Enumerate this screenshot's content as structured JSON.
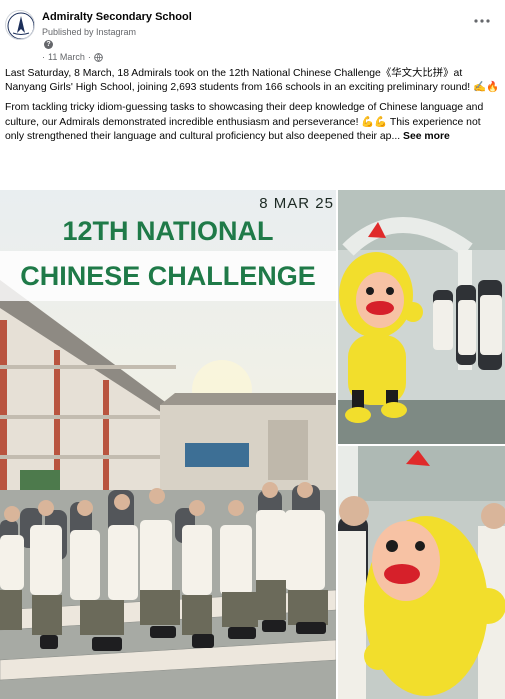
{
  "post": {
    "page_name": "Admiralty Secondary School",
    "published_by": "Published by Instagram",
    "meta_icon": "?",
    "date": "11 March",
    "date_separator": "·",
    "more_icon": "more-horizontal-icon",
    "privacy_icon": "globe-icon"
  },
  "text": {
    "p1": "Last Saturday, 8 March, 18 Admirals took on the 12th National Chinese Challenge《华文大比拼》at Nanyang Girls' High School, joining 2,693 students from 166 schools in an exciting preliminary round! ✍️🔥",
    "p2": "From tackling tricky idiom-guessing tasks to showcasing their deep knowledge of Chinese language and culture, our Admirals demonstrated incredible enthusiasm and perseverance! 💪💪 This experience not only strengthened their language and cultural proficiency but also deepened their ap...",
    "see_more": "See more"
  },
  "photos": {
    "main": {
      "date_text": "8 MAR 25",
      "title_line1": "12TH NATIONAL",
      "title_line2": "CHINESE CHALLENGE"
    }
  },
  "colors": {
    "banner_green": "#1f7a48",
    "mascot_yellow": "#f2de2c",
    "mascot_red": "#e02a2a",
    "meta_gray": "#65676b"
  }
}
